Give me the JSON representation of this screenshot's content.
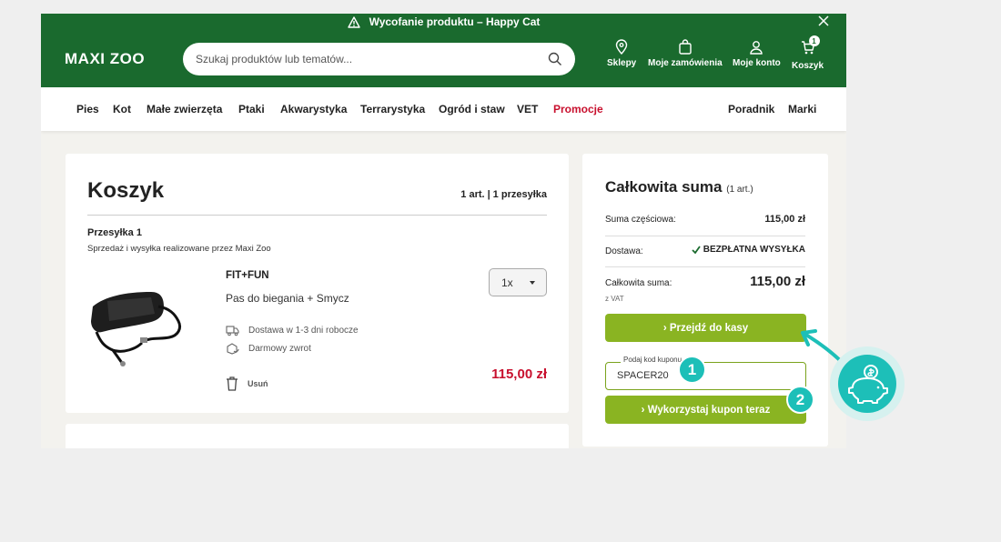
{
  "announcement": {
    "text": "Wycofanie produktu – Happy Cat"
  },
  "header": {
    "logo": "MAXI ZOO",
    "search_placeholder": "Szukaj produktów lub tematów...",
    "nav": {
      "stores": "Sklepy",
      "orders": "Moje zamówienia",
      "account": "Moje konto",
      "cart": "Koszyk",
      "cart_count": "1"
    }
  },
  "categories": [
    "Pies",
    "Kot",
    "Małe zwierzęta",
    "Ptaki",
    "Akwarystyka",
    "Terrarystyka",
    "Ogród i staw",
    "VET",
    "Promocje"
  ],
  "categories_right": [
    "Poradnik",
    "Marki"
  ],
  "cart": {
    "title": "Koszyk",
    "items_count": "1 art.",
    "shipments_count": "1 przesyłka",
    "shipment_title": "Przesyłka 1",
    "shipment_subtitle": "Sprzedaż i wysyłka realizowane przez Maxi Zoo",
    "product": {
      "brand": "FIT+FUN",
      "name": "Pas do biegania + Smycz",
      "quantity": "1x",
      "delivery": "Dostawa w 1-3 dni robocze",
      "return": "Darmowy zwrot",
      "remove": "Usuń",
      "price": "115,00 zł"
    }
  },
  "summary": {
    "title": "Całkowita suma",
    "title_count": "(1 art.)",
    "subtotal_label": "Suma częściowa:",
    "subtotal_value": "115,00 zł",
    "delivery_label": "Dostawa:",
    "delivery_value": "BEZPŁATNA WYSYŁKA",
    "total_label": "Całkowita suma:",
    "total_value": "115,00 zł",
    "vat_note": "z VAT",
    "checkout_button": "› Przejdź do kasy",
    "coupon_label": "Podaj kod kuponu",
    "coupon_value": "SPACER20",
    "coupon_button": "› Wykorzystaj kupon teraz"
  },
  "overlay": {
    "step1": "1",
    "step2": "2"
  },
  "colors": {
    "brand_green": "#1a6a2e",
    "button_green": "#8ab422",
    "promo_red": "#c8102e",
    "accent_teal": "#1dbfb8"
  }
}
